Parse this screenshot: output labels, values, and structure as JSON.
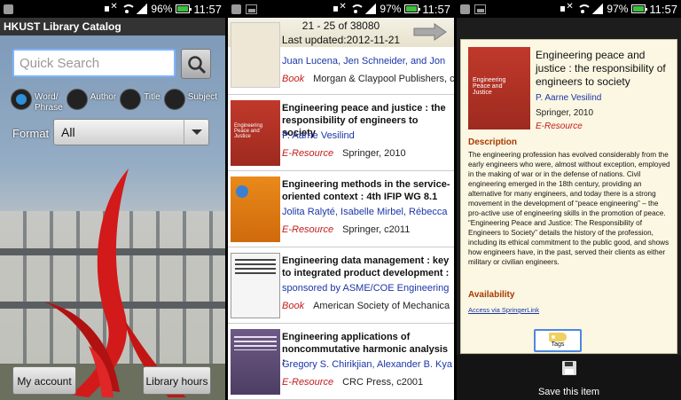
{
  "status": {
    "panel1": {
      "battery": "96%",
      "time": "11:57"
    },
    "panel2": {
      "battery": "97%",
      "time": "11:57"
    },
    "panel3": {
      "battery": "97%",
      "time": "11:57"
    }
  },
  "home": {
    "app_title": "HKUST Library Catalog",
    "search_placeholder": "Quick Search",
    "search_icon": "magnifier-icon",
    "radios": [
      {
        "label": "Word/\nPhrase",
        "selected": true
      },
      {
        "label": "Author",
        "selected": false
      },
      {
        "label": "Title",
        "selected": false
      },
      {
        "label": "Subject",
        "selected": false
      }
    ],
    "format_label": "Format",
    "format_value": "All",
    "my_account": "My account",
    "library_hours": "Library hours"
  },
  "results": {
    "range": "21 - 25 of 38080",
    "updated": "Last updated:2012-11-21",
    "items": [
      {
        "title": "",
        "authors": "Juan Lucena, Jen Schneider, and Jon",
        "type": "Book",
        "publisher": "Morgan & Claypool Publishers, c"
      },
      {
        "title": "Engineering peace and justice : the responsibility of engineers to society",
        "authors": "P. Aarne Vesilind",
        "type": "E-Resource",
        "publisher": "Springer, 2010"
      },
      {
        "title": "Engineering methods in the service-oriented context : 4th IFIP WG 8.1",
        "authors": "Jolita Ralyté, Isabelle Mirbel, Rébecca",
        "type": "E-Resource",
        "publisher": "Springer, c2011"
      },
      {
        "title": "Engineering data management : key to integrated product development :",
        "authors": "sponsored by ASME/COE Engineering",
        "type": "Book",
        "publisher": "American Society of Mechanica"
      },
      {
        "title": "Engineering applications of noncommutative harmonic analysis :",
        "authors": "Gregory S. Chirikjian, Alexander B. Kya",
        "type": "E-Resource",
        "publisher": "CRC Press, c2001"
      }
    ]
  },
  "detail": {
    "title": "Engineering peace and justice : the responsibility of engineers to society",
    "author": "P. Aarne Vesilind",
    "publisher": "Springer, 2010",
    "type": "E-Resource",
    "description_heading": "Description",
    "description": "The engineering profession has evolved considerably from the early engineers who were, almost without exception, employed in the making of war or in the defense of nations. Civil engineering emerged in the 18th century, providing an alternative for many engineers, and today there is a strong movement in the development of “peace engineering” – the pro-active use of engineering skills in the promotion of peace. “Engineering Peace and Justice: The Responsibility of Engineers to Society” details the history of the profession, including its ethical commitment to the public good, and shows how engineers have, in the past, served their clients as either military or civilian engineers.",
    "availability_heading": "Availability",
    "access_link": "Access via SpringerLink",
    "tags_label": "Tags",
    "save_label": "Save this item"
  }
}
